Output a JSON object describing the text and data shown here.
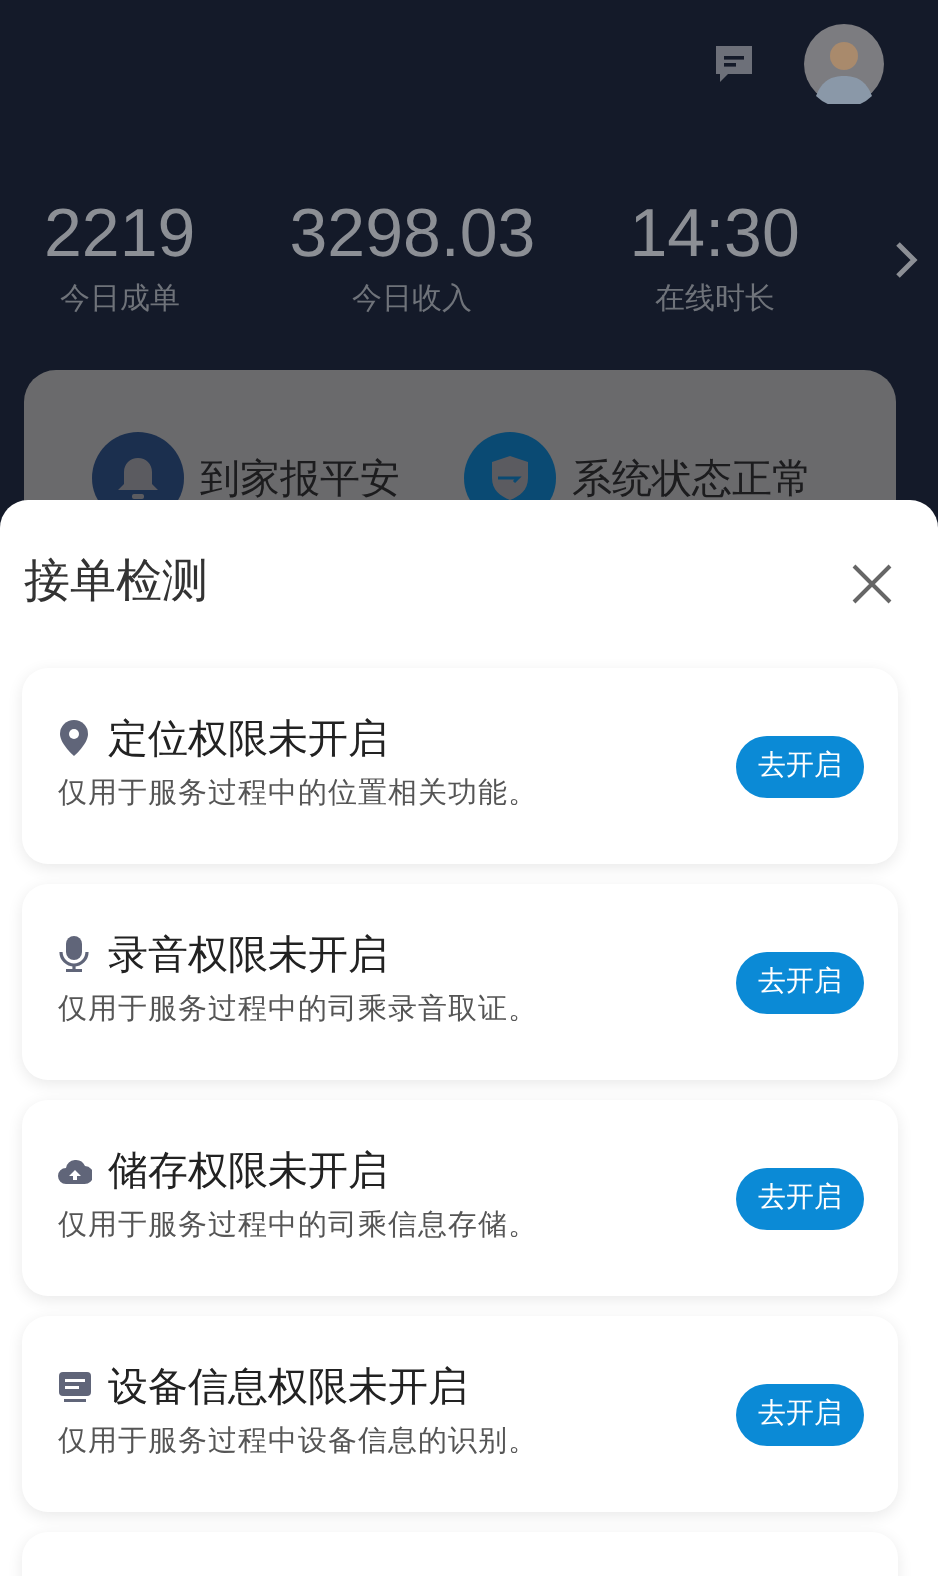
{
  "stats": [
    {
      "value": "2219",
      "label": "今日成单"
    },
    {
      "value": "3298.03",
      "label": "今日收入"
    },
    {
      "value": "14:30",
      "label": "在线时长"
    }
  ],
  "quick_items": [
    {
      "kind": "bell",
      "label": "到家报平安"
    },
    {
      "kind": "shield",
      "label": "系统状态正常"
    }
  ],
  "sheet": {
    "title": "接单检测",
    "permissions": [
      {
        "kind": "location",
        "title": "定位权限未开启",
        "description": "仅用于服务过程中的位置相关功能。",
        "button": "去开启"
      },
      {
        "kind": "mic",
        "title": "录音权限未开启",
        "description": "仅用于服务过程中的司乘录音取证。",
        "button": "去开启"
      },
      {
        "kind": "storage",
        "title": "储存权限未开启",
        "description": "仅用于服务过程中的司乘信息存储。",
        "button": "去开启"
      },
      {
        "kind": "device",
        "title": "设备信息权限未开启",
        "description": "仅用于服务过程中设备信息的识别。",
        "button": "去开启"
      }
    ]
  }
}
